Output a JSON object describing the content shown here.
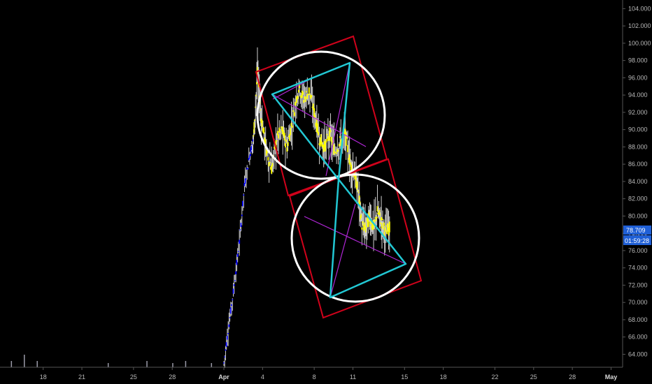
{
  "chart_data": {
    "type": "candlestick",
    "title": "",
    "ylim": [
      62.5,
      105
    ],
    "y_ticks": [
      "64.000",
      "66.000",
      "68.000",
      "70.000",
      "72.000",
      "74.000",
      "76.000",
      "78.000",
      "80.000",
      "82.000",
      "84.000",
      "86.000",
      "88.000",
      "90.000",
      "92.000",
      "94.000",
      "96.000",
      "98.000",
      "100.000",
      "102.000",
      "104.000"
    ],
    "x_ticks": [
      {
        "label": "18",
        "day": -14,
        "bold": false
      },
      {
        "label": "21",
        "day": -11,
        "bold": false
      },
      {
        "label": "25",
        "day": -7,
        "bold": false
      },
      {
        "label": "28",
        "day": -4,
        "bold": false
      },
      {
        "label": "Apr",
        "day": 0,
        "bold": true
      },
      {
        "label": "4",
        "day": 3,
        "bold": false
      },
      {
        "label": "8",
        "day": 7,
        "bold": false
      },
      {
        "label": "11",
        "day": 10,
        "bold": false
      },
      {
        "label": "15",
        "day": 14,
        "bold": false
      },
      {
        "label": "18",
        "day": 17,
        "bold": false
      },
      {
        "label": "22",
        "day": 21,
        "bold": false
      },
      {
        "label": "25",
        "day": 24,
        "bold": false
      },
      {
        "label": "28",
        "day": 27,
        "bold": false
      },
      {
        "label": "May",
        "day": 30,
        "bold": true
      }
    ],
    "price_line": [
      [
        0.0,
        63.0
      ],
      [
        0.4,
        67.5
      ],
      [
        0.8,
        72.0
      ],
      [
        1.2,
        77.0
      ],
      [
        1.6,
        83.5
      ],
      [
        2.0,
        87.0
      ],
      [
        2.3,
        89.0
      ],
      [
        2.6,
        96.5
      ],
      [
        2.9,
        91.5
      ],
      [
        3.3,
        87.5
      ],
      [
        3.7,
        85.5
      ],
      [
        4.1,
        89.0
      ],
      [
        4.5,
        90.0
      ],
      [
        4.9,
        88.0
      ],
      [
        5.3,
        91.0
      ],
      [
        5.8,
        95.0
      ],
      [
        6.2,
        93.5
      ],
      [
        6.6,
        94.5
      ],
      [
        7.0,
        92.0
      ],
      [
        7.4,
        89.0
      ],
      [
        7.8,
        88.0
      ],
      [
        8.2,
        89.5
      ],
      [
        8.6,
        87.5
      ],
      [
        9.0,
        88.5
      ],
      [
        9.4,
        89.5
      ],
      [
        9.8,
        86.0
      ],
      [
        10.1,
        85.0
      ],
      [
        10.4,
        83.0
      ],
      [
        10.7,
        79.0
      ],
      [
        11.0,
        78.5
      ],
      [
        11.3,
        80.0
      ],
      [
        11.6,
        78.5
      ],
      [
        11.9,
        80.5
      ],
      [
        12.2,
        79.5
      ],
      [
        12.5,
        78.2
      ],
      [
        12.9,
        78.7
      ]
    ],
    "history_volume_days": [
      -16.5,
      -15.5,
      -14.5,
      -9,
      -6,
      -4,
      -3,
      -1
    ],
    "last_price": "78.709",
    "countdown": "01:59:28",
    "price_color": "#ffff00",
    "rally_color": "#0000ff",
    "drawings": {
      "rectangle_color": "#d0021b",
      "circle_color": "#ffffff",
      "triangle_color": "#22c8d4",
      "median_color": "#b026d6"
    }
  }
}
